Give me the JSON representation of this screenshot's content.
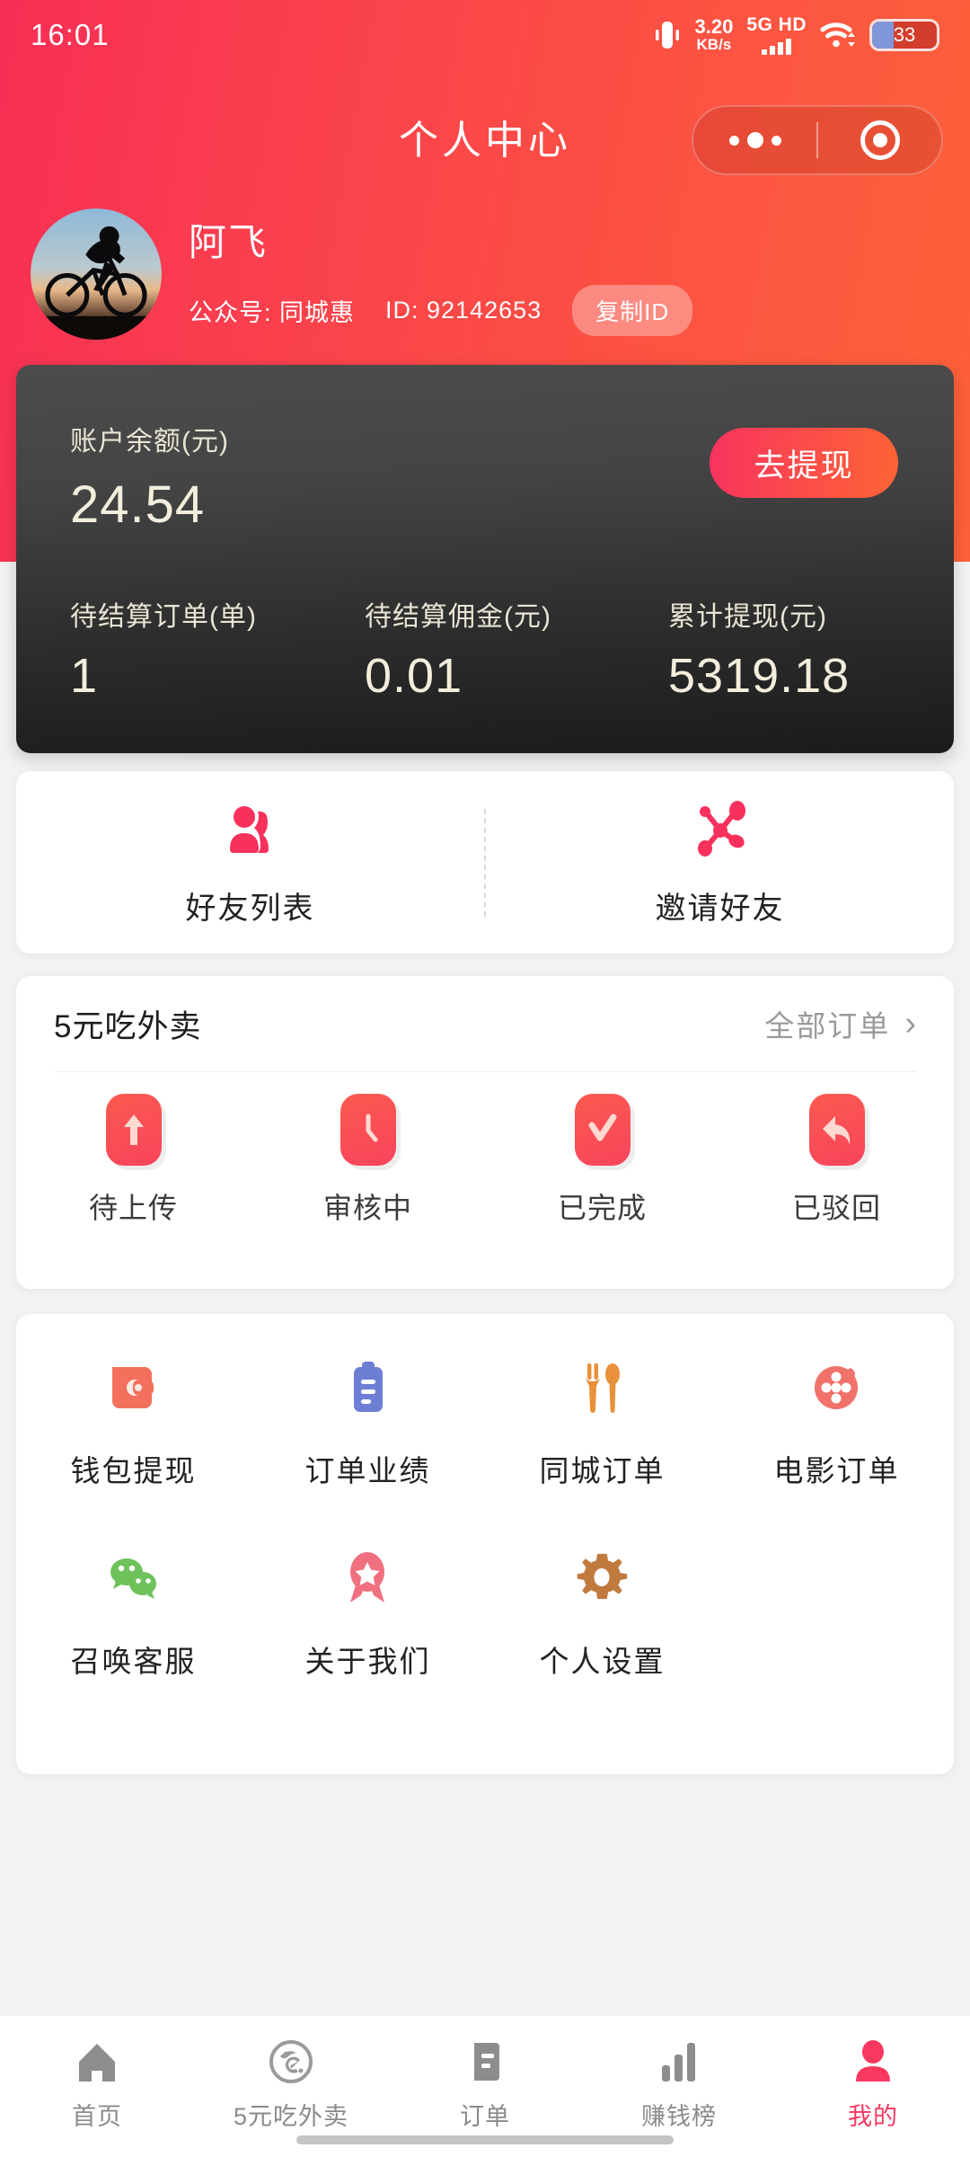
{
  "status_bar": {
    "clock": "16:01",
    "vibrate_icon": "vibrate-icon",
    "net_speed_value": "3.20",
    "net_speed_unit": "KB/s",
    "network_type": "5G HD",
    "signal_icon": "signal-bars-icon",
    "wifi_icon": "wifi-icon",
    "battery_percent": "33",
    "battery_level": 33
  },
  "nav": {
    "title": "个人中心",
    "more_icon": "more-dots-icon",
    "target_icon": "target-circle-icon"
  },
  "profile": {
    "avatar_icon": "cyclist-avatar",
    "name": "阿飞",
    "official_account": "公众号: 同城惠",
    "user_id": "ID: 92142653",
    "copy_id_label": "复制ID"
  },
  "balance": {
    "label": "账户余额(元)",
    "value": "24.54",
    "withdraw_label": "去提现",
    "stats": [
      {
        "label": "待结算订单(单)",
        "value": "1"
      },
      {
        "label": "待结算佣金(元)",
        "value": "0.01"
      },
      {
        "label": "累计提现(元)",
        "value": "5319.18"
      }
    ]
  },
  "friends": [
    {
      "label": "好友列表",
      "icon": "two-people-icon"
    },
    {
      "label": "邀请好友",
      "icon": "share-network-icon"
    }
  ],
  "orders": {
    "title": "5元吃外卖",
    "all_orders_label": "全部订单",
    "chevron_icon": "chevron-right-icon",
    "statuses": [
      {
        "label": "待上传",
        "icon": "upload-arrow-icon"
      },
      {
        "label": "审核中",
        "icon": "clock-icon"
      },
      {
        "label": "已完成",
        "icon": "check-icon"
      },
      {
        "label": "已驳回",
        "icon": "reply-arrow-icon"
      }
    ]
  },
  "menu": {
    "row1": [
      {
        "label": "钱包提现",
        "icon": "wallet-icon",
        "color": "#f3715c"
      },
      {
        "label": "订单业绩",
        "icon": "clipboard-icon",
        "color": "#6d7fd4"
      },
      {
        "label": "同城订单",
        "icon": "fork-spoon-icon",
        "color": "#e8913a"
      },
      {
        "label": "电影订单",
        "icon": "film-reel-icon",
        "color": "#f0726b"
      }
    ],
    "row2": [
      {
        "label": "召唤客服",
        "icon": "wechat-icon",
        "color": "#6fc25b"
      },
      {
        "label": "关于我们",
        "icon": "medal-icon",
        "color": "#f0707f"
      },
      {
        "label": "个人设置",
        "icon": "gear-icon",
        "color": "#c07a3e"
      }
    ]
  },
  "tabbar": [
    {
      "label": "首页",
      "icon": "home-icon",
      "active": false
    },
    {
      "label": "5元吃外卖",
      "icon": "eleme-logo-icon",
      "active": false
    },
    {
      "label": "订单",
      "icon": "order-list-icon",
      "active": false
    },
    {
      "label": "赚钱榜",
      "icon": "bar-chart-icon",
      "active": false
    },
    {
      "label": "我的",
      "icon": "person-icon",
      "active": true
    }
  ],
  "colors": {
    "accent_pink": "#f8335f",
    "accent_orange": "#fd6134",
    "card_dark": "#3a3a3a",
    "page_bg": "#f2f2f2",
    "muted_text": "#9a9a9a"
  }
}
